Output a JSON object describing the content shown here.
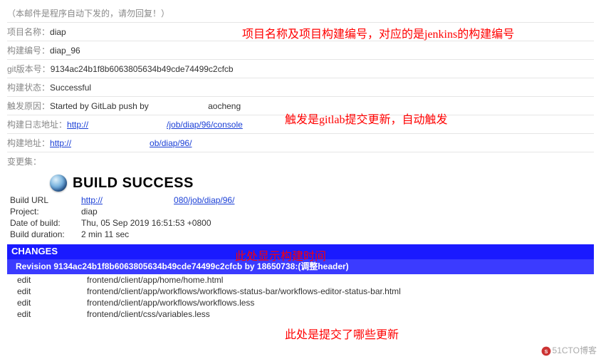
{
  "notice": "（本邮件是程序自动下发的，请勿回复！）",
  "rows": {
    "project_name_label": "项目名称：",
    "project_name": "diap",
    "build_no_label": "构建编号：",
    "build_no": "diap_96",
    "git_label": "git版本号：",
    "git": "9134ac24b1f8b6063805634b49cde74499c2cfcb",
    "status_label": "构建状态：",
    "status": "Successful",
    "trigger_label": "触发原因：",
    "trigger_prefix": "Started by GitLab push by ",
    "trigger_user": "aocheng",
    "log_url_label": "构建日志地址：",
    "log_url_1": "http://",
    "log_url_2": "/job/diap/96/console",
    "build_url_label": "构建地址：",
    "build_url_1": "http://",
    "build_url_2": "ob/diap/96/"
  },
  "changeset_label": "变更集：",
  "success_title": "BUILD SUCCESS",
  "build_info": {
    "url_label": "Build URL",
    "url_1": "http://",
    "url_2": "080/job/diap/96/",
    "project_label": "Project:",
    "project": "diap",
    "date_label": "Date of build:",
    "date": "Thu, 05 Sep 2019 16:51:53 +0800",
    "duration_label": "Build duration:",
    "duration": "2 min 11 sec"
  },
  "changes": {
    "header": "CHANGES",
    "revision_prefix": "Revision ",
    "revision_hash": "9134ac24b1f8b6063805634b49cde74499c2cfcb",
    "revision_by": " by ",
    "revision_author": "18650738:",
    "revision_msg": "(调整header)",
    "files": [
      {
        "op": "edit",
        "path": "frontend/client/app/home/home.html"
      },
      {
        "op": "edit",
        "path": "frontend/client/app/workflows/workflows-status-bar/workflows-editor-status-bar.html"
      },
      {
        "op": "edit",
        "path": "frontend/client/app/workflows/workflows.less"
      },
      {
        "op": "edit",
        "path": "frontend/client/css/variables.less"
      }
    ]
  },
  "annotations": {
    "a1": "项目名称及项目构建编号，对应的是jenkins的构建编号",
    "a2": "触发是gitlab提交更新，自动触发",
    "a3": "此处显示构建时间",
    "a4": "此处是提交了哪些更新"
  },
  "watermark": "51CTO博客"
}
